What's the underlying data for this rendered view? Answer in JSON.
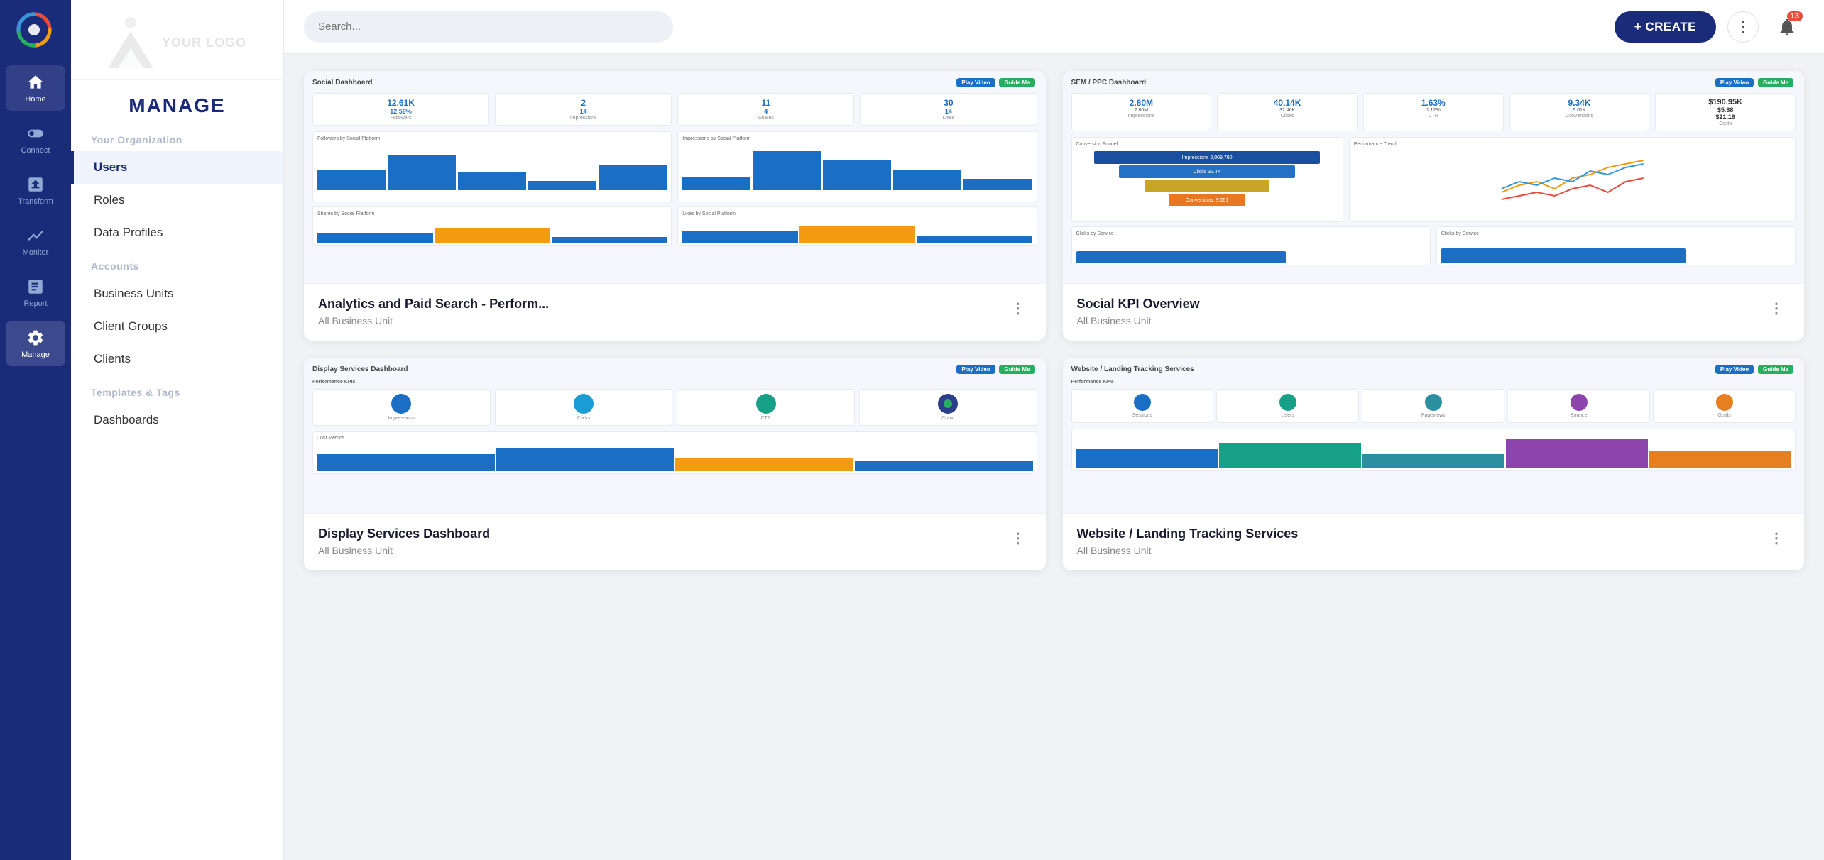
{
  "iconNav": {
    "items": [
      {
        "id": "home",
        "label": "Home",
        "icon": "🏠"
      },
      {
        "id": "connect",
        "label": "Connect",
        "icon": "🔌"
      },
      {
        "id": "transform",
        "label": "Transform",
        "icon": "✦"
      },
      {
        "id": "monitor",
        "label": "Monitor",
        "icon": "📈"
      },
      {
        "id": "report",
        "label": "Report",
        "icon": "📋"
      },
      {
        "id": "manage",
        "label": "Manage",
        "icon": "⚙"
      }
    ],
    "active": "manage"
  },
  "sidebar": {
    "logoText": "YOUR LOGO",
    "manageTitle": "MANAGE",
    "sections": [
      {
        "label": "Your Organization",
        "items": [
          {
            "id": "users",
            "label": "Users",
            "active": true
          },
          {
            "id": "roles",
            "label": "Roles",
            "active": false
          },
          {
            "id": "data-profiles",
            "label": "Data Profiles",
            "active": false
          }
        ]
      },
      {
        "label": "Accounts",
        "items": [
          {
            "id": "business-units",
            "label": "Business Units",
            "active": false
          },
          {
            "id": "client-groups",
            "label": "Client Groups",
            "active": false
          },
          {
            "id": "clients",
            "label": "Clients",
            "active": false
          }
        ]
      },
      {
        "label": "Templates & Tags",
        "items": [
          {
            "id": "dashboards",
            "label": "Dashboards",
            "active": false
          }
        ]
      }
    ]
  },
  "topbar": {
    "searchPlaceholder": "Search...",
    "createLabel": "+ CREATE",
    "notificationCount": "13"
  },
  "cards": [
    {
      "id": "analytics-paid-search",
      "title": "Analytics and Paid Search - Perform...",
      "subtitle": "All Business Unit",
      "dashboardTitle": "Social Dashboard",
      "type": "social"
    },
    {
      "id": "social-kpi-overview",
      "title": "Social KPI Overview",
      "subtitle": "All Business Unit",
      "dashboardTitle": "SEM / PPC Dashboard",
      "type": "sem"
    },
    {
      "id": "display-services",
      "title": "Display Services Dashboard",
      "subtitle": "All Business Unit",
      "dashboardTitle": "Display Services Dashboard",
      "type": "display"
    },
    {
      "id": "website-landing",
      "title": "Website / Landing Tracking Services",
      "subtitle": "All Business Unit",
      "dashboardTitle": "Website / Landing Tracking Services",
      "type": "website"
    }
  ]
}
